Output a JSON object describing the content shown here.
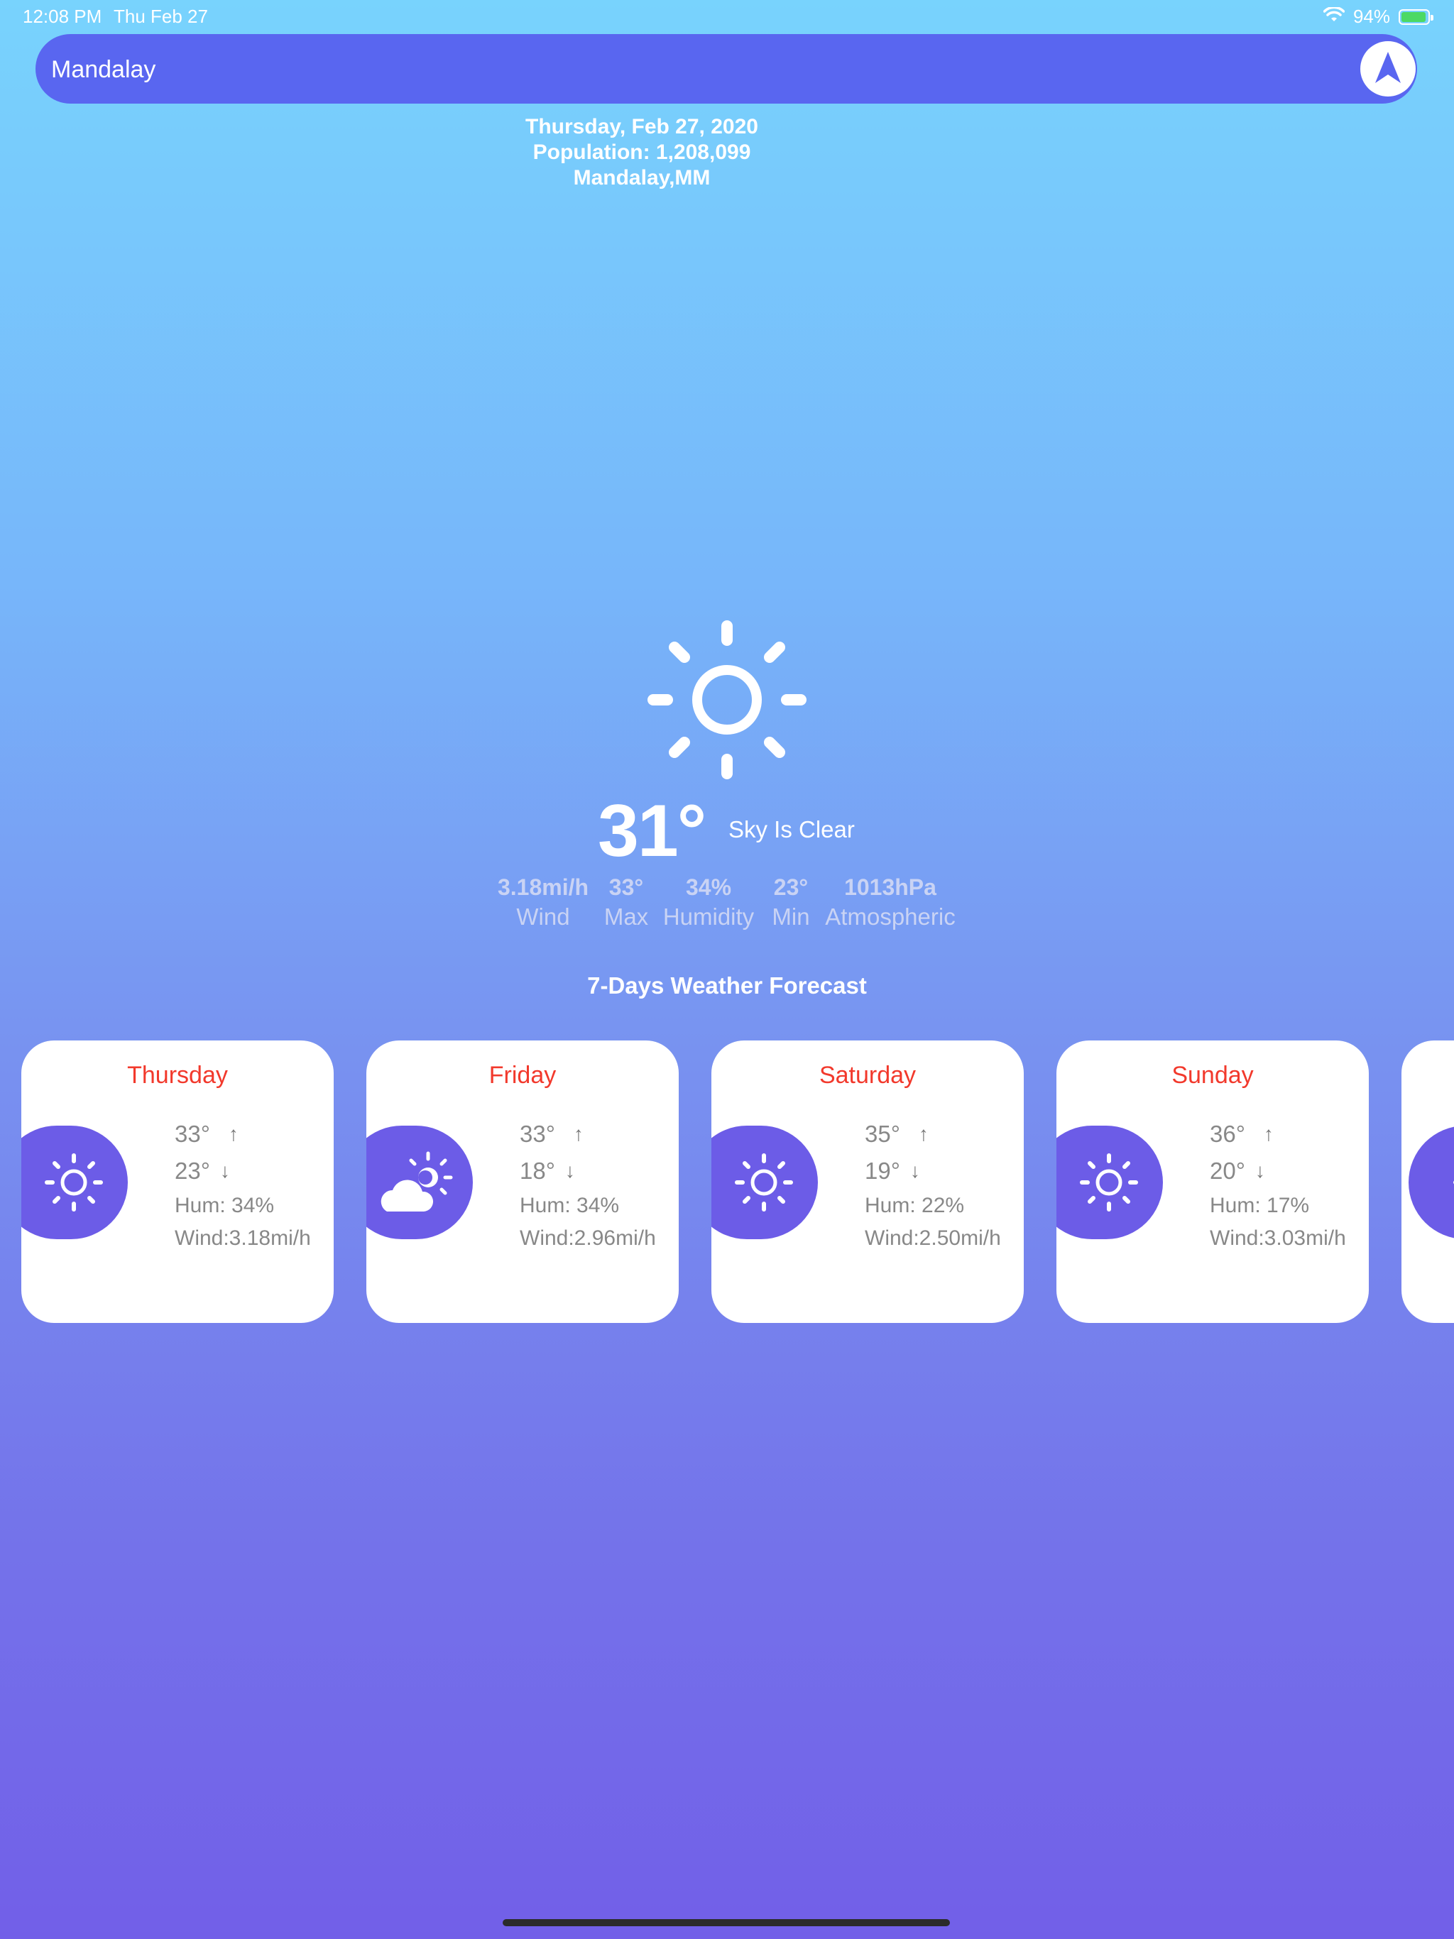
{
  "status_bar": {
    "time": "12:08 PM",
    "date": "Thu Feb 27",
    "battery": "94%",
    "battery_level": 0.94
  },
  "search": {
    "value": "Mandalay",
    "placeholder": ""
  },
  "header": {
    "date": "Thursday, Feb 27, 2020",
    "population": "Population: 1,208,099",
    "location": "Mandalay,MM"
  },
  "current": {
    "icon": "sun-icon",
    "temperature": "31°",
    "description": "Sky Is Clear",
    "stats": [
      {
        "value": "3.18mi/h",
        "label": "Wind"
      },
      {
        "value": "33°",
        "label": "Max"
      },
      {
        "value": "34%",
        "label": "Humidity"
      },
      {
        "value": "23°",
        "label": "Min"
      },
      {
        "value": "1013hPa",
        "label": "Atmospheric"
      }
    ]
  },
  "forecast": {
    "title": "7-Days Weather Forecast",
    "days": [
      {
        "day": "Thursday",
        "icon": "sun-icon",
        "max": "33°",
        "min": "23°",
        "humidity": "Hum: 34%",
        "wind": "Wind:3.18mi/h"
      },
      {
        "day": "Friday",
        "icon": "partly-cloudy-icon",
        "max": "33°",
        "min": "18°",
        "humidity": "Hum: 34%",
        "wind": "Wind:2.96mi/h"
      },
      {
        "day": "Saturday",
        "icon": "sun-icon",
        "max": "35°",
        "min": "19°",
        "humidity": "Hum: 22%",
        "wind": "Wind:2.50mi/h"
      },
      {
        "day": "Sunday",
        "icon": "sun-icon",
        "max": "36°",
        "min": "20°",
        "humidity": "Hum: 17%",
        "wind": "Wind:3.03mi/h"
      }
    ]
  },
  "colors": {
    "accent": "#5966f0",
    "icon_bg": "#6c5ce7",
    "day_label": "#f2392c"
  }
}
